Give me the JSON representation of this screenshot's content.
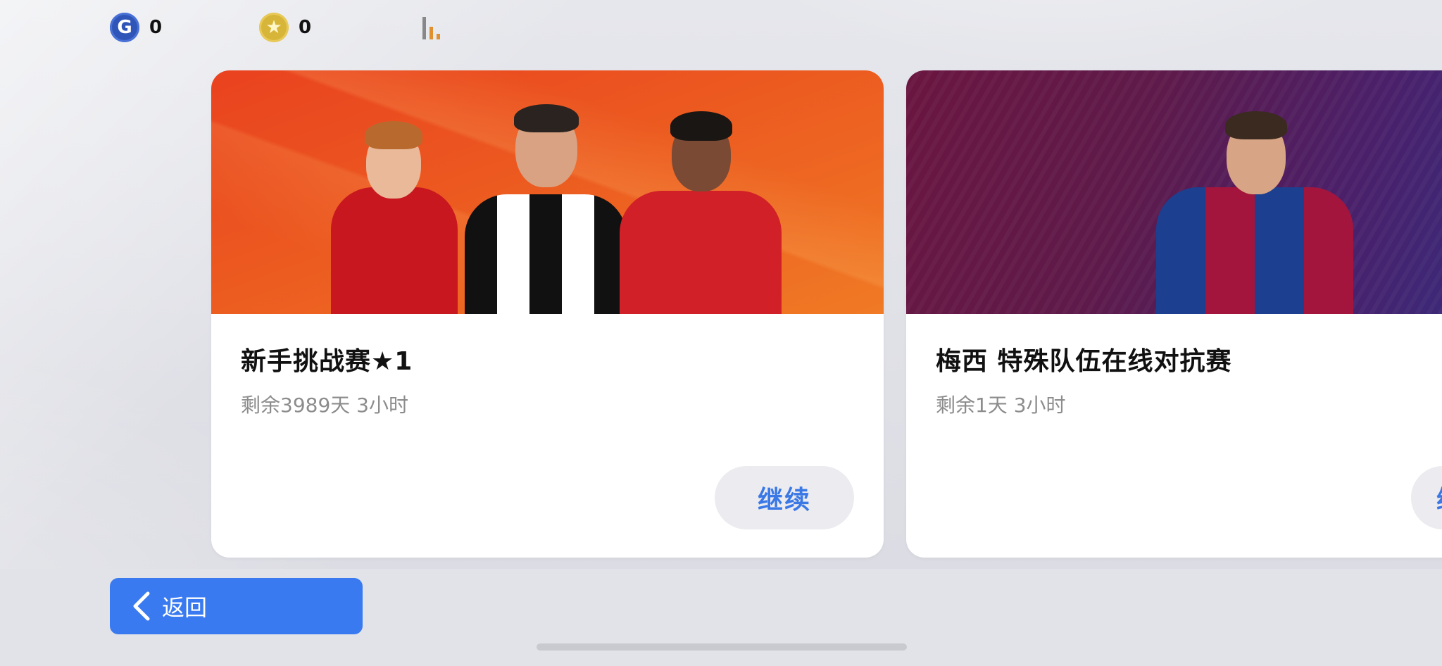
{
  "currency": {
    "gp": {
      "icon": "g-coin-icon",
      "glyph": "G",
      "amount": "0"
    },
    "coins": {
      "icon": "star-coin-icon",
      "glyph": "★",
      "amount": "0"
    },
    "network": {
      "icon": "signal-strength-icon"
    }
  },
  "events": [
    {
      "title": "新手挑战赛★1",
      "remaining": "剩余3989天 3小时",
      "action_label": "继续",
      "banner_color": "#ec5a20"
    },
    {
      "title": "梅西 特殊队伍在线对抗赛",
      "remaining": "剩余1天 3小时",
      "action_label": "继",
      "banner_color": "#5e1a4a"
    }
  ],
  "footer": {
    "back_label": "返回"
  },
  "colors": {
    "accent": "#3a7af0",
    "action_text": "#3a78e6"
  }
}
